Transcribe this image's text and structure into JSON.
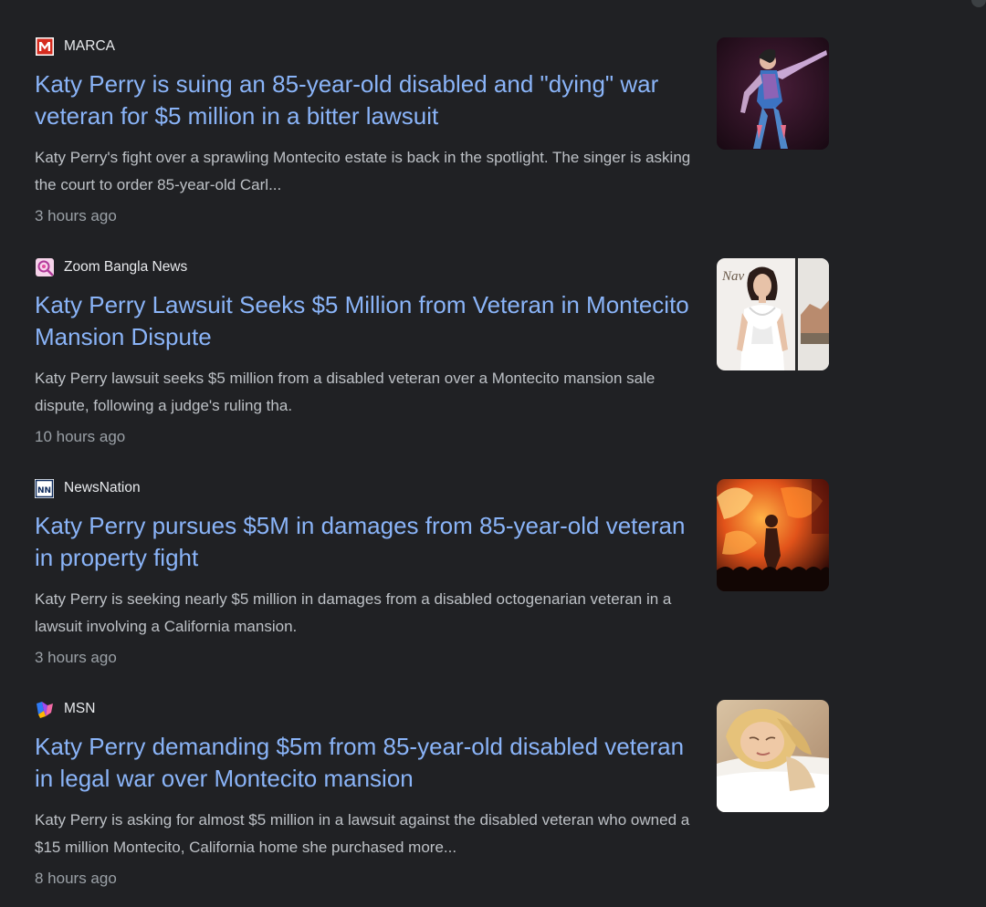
{
  "partial_top_text": "",
  "articles": [
    {
      "source": "MARCA",
      "favicon": "marca-logo-icon",
      "headline": "Katy Perry is suing an 85-year-old disabled and \"dying\" war veteran for $5 million in a bitter lawsuit",
      "snippet": "Katy Perry's fight over a sprawling Montecito estate is back in the spotlight. The singer is asking the court to order 85-year-old Carl...",
      "age": "3 hours ago"
    },
    {
      "source": "Zoom Bangla News",
      "favicon": "zoom-bangla-logo-icon",
      "headline": "Katy Perry Lawsuit Seeks $5 Million from Veteran in Montecito Mansion Dispute",
      "snippet": "Katy Perry lawsuit seeks $5 million from a disabled veteran over a Montecito mansion sale dispute, following a judge's ruling tha.",
      "age": "10 hours ago"
    },
    {
      "source": "NewsNation",
      "favicon": "newsnation-logo-icon",
      "headline": "Katy Perry pursues $5M in damages from 85-year-old veteran in property fight",
      "snippet": "Katy Perry is seeking nearly $5 million in damages from a disabled octogenarian veteran in a lawsuit involving a California mansion.",
      "age": "3 hours ago"
    },
    {
      "source": "MSN",
      "favicon": "msn-logo-icon",
      "headline": "Katy Perry demanding $5m from 85-year-old disabled veteran in legal war over Montecito mansion",
      "snippet": "Katy Perry is asking for almost $5 million in a lawsuit against the disabled veteran who owned a $15 million Montecito, California home she purchased more...",
      "age": "8 hours ago"
    }
  ],
  "colors": {
    "background": "#202124",
    "headline": "#8ab4f8",
    "source": "#e8eaed",
    "snippet": "#bdc1c6",
    "age": "#9aa0a6"
  }
}
